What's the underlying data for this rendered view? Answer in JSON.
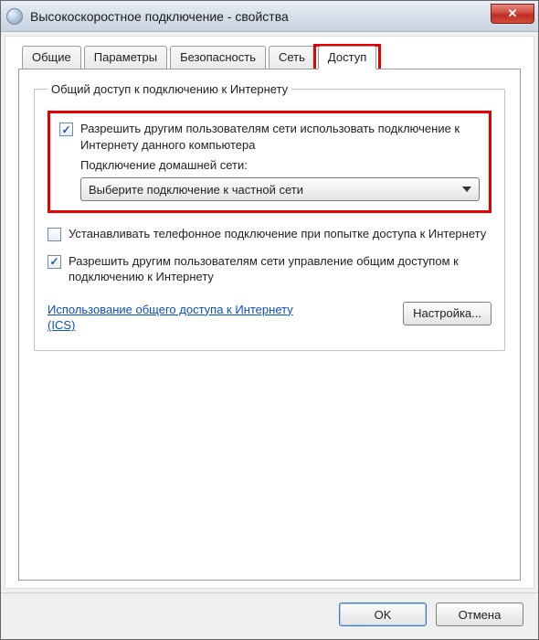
{
  "window": {
    "title": "Высокоскоростное подключение - свойства",
    "close_glyph": "✕"
  },
  "tabs": {
    "items": [
      {
        "label": "Общие"
      },
      {
        "label": "Параметры"
      },
      {
        "label": "Безопасность"
      },
      {
        "label": "Сеть"
      },
      {
        "label": "Доступ"
      }
    ],
    "active_index": 4
  },
  "group": {
    "legend": "Общий доступ к подключению к Интернету",
    "allow_share": {
      "checked": true,
      "label": "Разрешить другим пользователям сети использовать подключение к Интернету данного компьютера",
      "sublabel": "Подключение домашней сети:",
      "combo_value": "Выберите подключение к частной сети"
    },
    "dial_on_demand": {
      "checked": false,
      "label": "Устанавливать телефонное подключение при попытке доступа к Интернету"
    },
    "allow_control": {
      "checked": true,
      "label": "Разрешить другим пользователям сети управление общим доступом к подключению к Интернету"
    },
    "link_text": "Использование общего доступа к Интернету (ICS)",
    "settings_button": "Настройка..."
  },
  "footer": {
    "ok": "OK",
    "cancel": "Отмена"
  }
}
